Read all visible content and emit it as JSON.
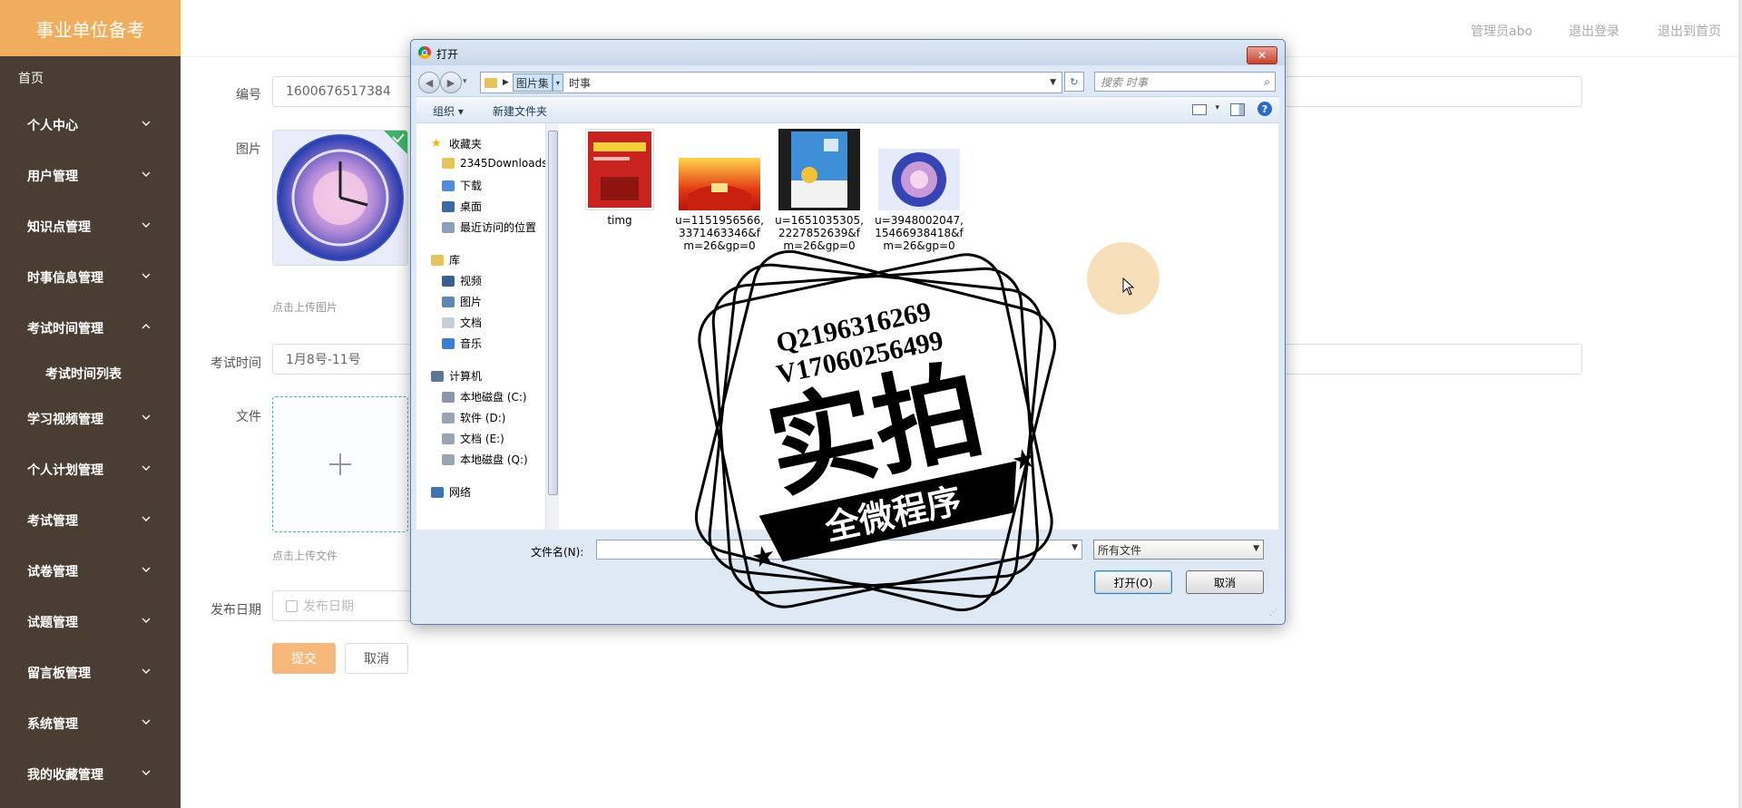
{
  "sidebar": {
    "brand": "事业单位备考",
    "home": "首页",
    "items": [
      {
        "label": "个人中心",
        "open": false
      },
      {
        "label": "用户管理",
        "open": false
      },
      {
        "label": "知识点管理",
        "open": false
      },
      {
        "label": "时事信息管理",
        "open": false
      },
      {
        "label": "考试时间管理",
        "open": true
      },
      {
        "label": "学习视频管理",
        "open": false
      },
      {
        "label": "个人计划管理",
        "open": false
      },
      {
        "label": "考试管理",
        "open": false
      },
      {
        "label": "试卷管理",
        "open": false
      },
      {
        "label": "试题管理",
        "open": false
      },
      {
        "label": "留言板管理",
        "open": false
      },
      {
        "label": "系统管理",
        "open": false
      },
      {
        "label": "我的收藏管理",
        "open": false
      }
    ],
    "sub_item": "考试时间列表"
  },
  "topbar": {
    "admin": "管理员abo",
    "logout": "退出登录",
    "back_home": "退出到首页"
  },
  "form": {
    "id_label": "编号",
    "id_value": "1600676517384",
    "image_label": "图片",
    "image_hint": "点击上传图片",
    "exam_time_label": "考试时间",
    "exam_time_value": "1月8号-11号",
    "file_label": "文件",
    "file_hint": "点击上传文件",
    "publish_label": "发布日期",
    "publish_placeholder": "发布日期",
    "submit": "提交",
    "cancel": "取消"
  },
  "dialog": {
    "title": "打开",
    "close": "✕",
    "path": [
      "图片集",
      "时事"
    ],
    "search_placeholder": "搜索 时事",
    "toolbar": {
      "organize": "组织 ▾",
      "new_folder": "新建文件夹"
    },
    "tree": [
      {
        "label": "收藏夹",
        "icon": "star-icon",
        "color": "#f2b51c",
        "indent": 0
      },
      {
        "label": "2345Downloads",
        "icon": "folder-icon",
        "color": "#e8c25a",
        "indent": 1
      },
      {
        "label": "下载",
        "icon": "download-icon",
        "color": "#4f8bd6",
        "indent": 1
      },
      {
        "label": "桌面",
        "icon": "desktop-icon",
        "color": "#3b6aa8",
        "indent": 1
      },
      {
        "label": "最近访问的位置",
        "icon": "recent-icon",
        "color": "#8ba1bb",
        "indent": 1
      },
      {
        "label": "库",
        "icon": "library-icon",
        "color": "#e8c25a",
        "indent": 0
      },
      {
        "label": "视频",
        "icon": "video-icon",
        "color": "#3b5f8f",
        "indent": 1
      },
      {
        "label": "图片",
        "icon": "picture-icon",
        "color": "#5b87b5",
        "indent": 1
      },
      {
        "label": "文档",
        "icon": "document-icon",
        "color": "#c6ced8",
        "indent": 1
      },
      {
        "label": "音乐",
        "icon": "music-icon",
        "color": "#3c7fd0",
        "indent": 1
      },
      {
        "label": "计算机",
        "icon": "computer-icon",
        "color": "#5c7896",
        "indent": 0
      },
      {
        "label": "本地磁盘 (C:)",
        "icon": "disk-icon",
        "color": "#8a97a6",
        "indent": 1
      },
      {
        "label": "软件 (D:)",
        "icon": "disk-icon",
        "color": "#9aa5b2",
        "indent": 1
      },
      {
        "label": "文档 (E:)",
        "icon": "disk-icon",
        "color": "#9aa5b2",
        "indent": 1
      },
      {
        "label": "本地磁盘 (Q:)",
        "icon": "disk-icon",
        "color": "#9aa5b2",
        "indent": 1
      },
      {
        "label": "网络",
        "icon": "network-icon",
        "color": "#3f74b4",
        "indent": 0
      }
    ],
    "files": [
      {
        "name": "timg",
        "lines": [
          "timg"
        ]
      },
      {
        "name": "u1",
        "lines": [
          "u=1151956566,",
          "3371463346&f",
          "m=26&gp=0"
        ]
      },
      {
        "name": "u2",
        "lines": [
          "u=1651035305,",
          "2227852639&f",
          "m=26&gp=0"
        ]
      },
      {
        "name": "u3",
        "lines": [
          "u=3948002047,",
          "15466938418&f",
          "m=26&gp=0"
        ]
      }
    ],
    "filename_label": "文件名(N):",
    "filter": "所有文件",
    "open": "打开(O)",
    "cancel": "取消"
  },
  "watermark": {
    "line1": "Q2196316269",
    "line2": "V17060256499",
    "main": "实拍",
    "sub": "全微程序"
  }
}
